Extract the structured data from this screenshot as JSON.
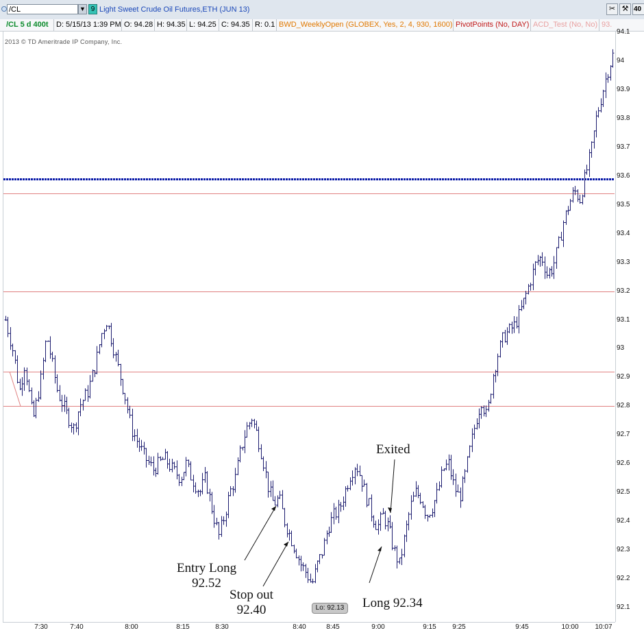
{
  "toolbar": {
    "symbol": "/CL",
    "link_number": "9",
    "description": "Light Sweet Crude Oil Futures,ETH (JUN 13)",
    "zoom_label": "40"
  },
  "infobar": {
    "chart_setting": "/CL 5 d 400t",
    "date": "D: 5/15/13 1:39 PM",
    "open": "O: 94.28",
    "high": "H: 94.35",
    "low": "L: 94.25",
    "close": "C: 94.35",
    "range": "R: 0.1",
    "study_weekly_open": "BWD_WeeklyOpen (GLOBEX, Yes, 2, 4, 930, 1600)",
    "study_pivot": "PivotPoints (No, DAY)",
    "study_acd": "ACD_Test (No, No)",
    "study_more": "93."
  },
  "copyright": "2013 © TD Ameritrade IP Company, Inc.",
  "low_badge": "Lo: 92.13",
  "annotations": {
    "entry_line1": "Entry Long",
    "entry_line2": "92.52",
    "stop_line1": "Stop out",
    "stop_line2": "92.40",
    "exited": "Exited",
    "long": "Long 92.34"
  },
  "colors": {
    "bars": "#1a1a6e",
    "weekly_open_line": "#0a1aa8",
    "pivot_lines": "#e08080",
    "symbol_accent": "#1a47b8",
    "setting_text": "#0a8a2a",
    "weekly_open_text": "#e07800",
    "pivot_text": "#c01818",
    "acd_text": "#e8a0a0"
  },
  "chart_data": {
    "type": "ohlc",
    "instrument": "/CL",
    "y_axis": {
      "ylim": [
        92.07,
        94.12
      ],
      "ticks": [
        "92.1",
        "92.2",
        "92.3",
        "92.4",
        "92.5",
        "92.6",
        "92.7",
        "92.8",
        "92.9",
        "93",
        "93.1",
        "93.2",
        "93.3",
        "93.4",
        "93.5",
        "93.6",
        "93.7",
        "93.8",
        "93.9",
        "94",
        "94.1"
      ]
    },
    "x_axis": {
      "ticks": [
        "7:30",
        "7:40",
        "8:00",
        "8:15",
        "8:30",
        "8:40",
        "8:45",
        "9:00",
        "9:15",
        "9:25",
        "9:45",
        "10:00",
        "10:07"
      ]
    },
    "horizontal_lines": [
      {
        "kind": "weekly_open",
        "value": 93.59,
        "style": "dotted"
      },
      {
        "kind": "pivot",
        "value": 93.54
      },
      {
        "kind": "pivot",
        "value": 93.2
      },
      {
        "kind": "pivot",
        "value": 92.92
      },
      {
        "kind": "pivot",
        "value": 92.8
      }
    ],
    "close_path": [
      [
        0,
        93.1
      ],
      [
        3,
        92.98
      ],
      [
        5,
        92.85
      ],
      [
        7,
        92.95
      ],
      [
        10,
        92.75
      ],
      [
        13,
        92.9
      ],
      [
        15,
        93.05
      ],
      [
        17,
        92.95
      ],
      [
        19,
        92.85
      ],
      [
        22,
        92.78
      ],
      [
        25,
        92.72
      ],
      [
        27,
        92.8
      ],
      [
        30,
        92.85
      ],
      [
        33,
        92.95
      ],
      [
        35,
        93.05
      ],
      [
        37,
        93.1
      ],
      [
        39,
        93.02
      ],
      [
        42,
        92.9
      ],
      [
        44,
        92.82
      ],
      [
        46,
        92.72
      ],
      [
        48,
        92.68
      ],
      [
        51,
        92.62
      ],
      [
        54,
        92.58
      ],
      [
        56,
        92.6
      ],
      [
        58,
        92.62
      ],
      [
        61,
        92.58
      ],
      [
        64,
        92.55
      ],
      [
        66,
        92.6
      ],
      [
        68,
        92.55
      ],
      [
        71,
        92.5
      ],
      [
        73,
        92.55
      ],
      [
        76,
        92.42
      ],
      [
        78,
        92.35
      ],
      [
        80,
        92.42
      ],
      [
        82,
        92.5
      ],
      [
        84,
        92.55
      ],
      [
        86,
        92.65
      ],
      [
        88,
        92.72
      ],
      [
        90,
        92.76
      ],
      [
        92,
        92.7
      ],
      [
        94,
        92.62
      ],
      [
        96,
        92.52
      ],
      [
        98,
        92.46
      ],
      [
        100,
        92.48
      ],
      [
        102,
        92.4
      ],
      [
        104,
        92.35
      ],
      [
        106,
        92.3
      ],
      [
        108,
        92.25
      ],
      [
        110,
        92.22
      ],
      [
        112,
        92.18
      ],
      [
        114,
        92.25
      ],
      [
        116,
        92.3
      ],
      [
        118,
        92.38
      ],
      [
        120,
        92.42
      ],
      [
        122,
        92.44
      ],
      [
        124,
        92.5
      ],
      [
        126,
        92.56
      ],
      [
        128,
        92.6
      ],
      [
        130,
        92.55
      ],
      [
        132,
        92.48
      ],
      [
        134,
        92.42
      ],
      [
        136,
        92.38
      ],
      [
        138,
        92.42
      ],
      [
        140,
        92.38
      ],
      [
        142,
        92.3
      ],
      [
        144,
        92.25
      ],
      [
        146,
        92.35
      ],
      [
        148,
        92.45
      ],
      [
        150,
        92.5
      ],
      [
        152,
        92.48
      ],
      [
        154,
        92.42
      ],
      [
        156,
        92.45
      ],
      [
        158,
        92.5
      ],
      [
        160,
        92.58
      ],
      [
        162,
        92.6
      ],
      [
        164,
        92.52
      ],
      [
        166,
        92.48
      ],
      [
        168,
        92.56
      ],
      [
        170,
        92.66
      ],
      [
        172,
        92.75
      ],
      [
        174,
        92.82
      ],
      [
        176,
        92.76
      ],
      [
        178,
        92.9
      ],
      [
        180,
        92.98
      ],
      [
        182,
        93.04
      ],
      [
        184,
        93.06
      ],
      [
        186,
        93.08
      ],
      [
        188,
        93.12
      ],
      [
        190,
        93.18
      ],
      [
        192,
        93.24
      ],
      [
        194,
        93.3
      ],
      [
        196,
        93.32
      ],
      [
        198,
        93.26
      ],
      [
        200,
        93.28
      ],
      [
        202,
        93.35
      ],
      [
        204,
        93.44
      ],
      [
        206,
        93.5
      ],
      [
        208,
        93.55
      ],
      [
        210,
        93.52
      ],
      [
        212,
        93.6
      ],
      [
        214,
        93.68
      ],
      [
        216,
        93.8
      ],
      [
        218,
        93.88
      ],
      [
        220,
        93.96
      ],
      [
        222,
        94.02
      ]
    ]
  }
}
